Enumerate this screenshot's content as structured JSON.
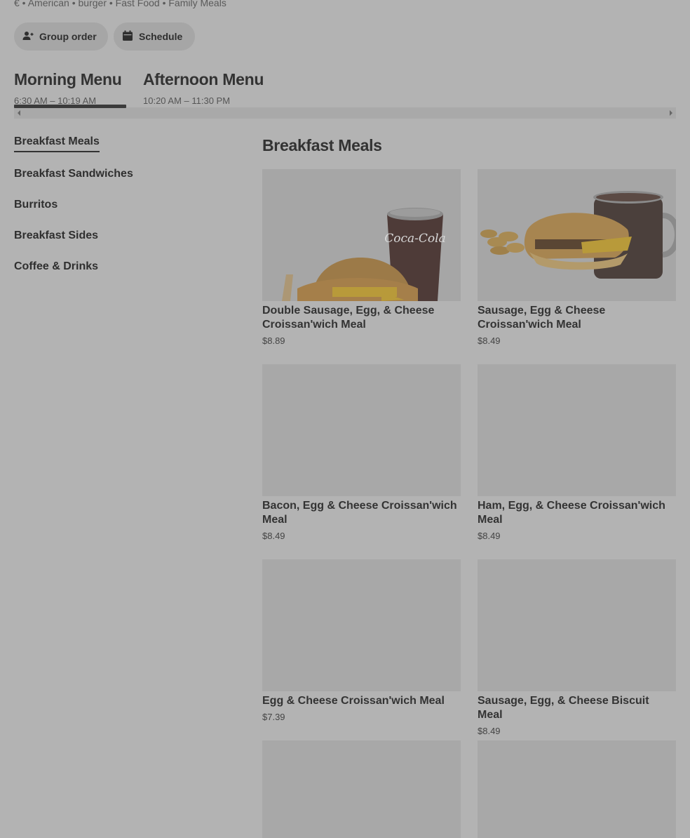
{
  "store": {
    "tags": "€ • American • burger • Fast Food • Family Meals"
  },
  "actions": {
    "group_order": "Group order",
    "schedule": "Schedule"
  },
  "menus": [
    {
      "title": "Morning Menu",
      "hours": "6:30 AM – 10:19 AM"
    },
    {
      "title": "Afternoon Menu",
      "hours": "10:20 AM – 11:30 PM"
    }
  ],
  "sidebar": {
    "items": [
      {
        "label": "Breakfast Meals"
      },
      {
        "label": "Breakfast Sandwiches"
      },
      {
        "label": "Burritos"
      },
      {
        "label": "Breakfast Sides"
      },
      {
        "label": "Coffee & Drinks"
      }
    ]
  },
  "section": {
    "title": "Breakfast Meals"
  },
  "products": [
    {
      "name": "Double Sausage, Egg, & Cheese Croissan'wich Meal",
      "price": "$8.89"
    },
    {
      "name": "Sausage, Egg & Cheese Croissan'wich Meal",
      "price": "$8.49"
    },
    {
      "name": "Bacon, Egg & Cheese Croissan'wich Meal",
      "price": "$8.49"
    },
    {
      "name": "Ham, Egg, & Cheese Croissan'wich Meal",
      "price": "$8.49"
    },
    {
      "name": "Egg & Cheese Croissan'wich Meal",
      "price": "$7.39"
    },
    {
      "name": "Sausage, Egg, & Cheese Biscuit Meal",
      "price": "$8.49"
    }
  ],
  "images": {
    "cup_logo": "Coca-Cola"
  },
  "colors": {
    "overlay_bg": "#b3b3b3",
    "text": "#333333",
    "image_placeholder": "#a8a8a8"
  }
}
